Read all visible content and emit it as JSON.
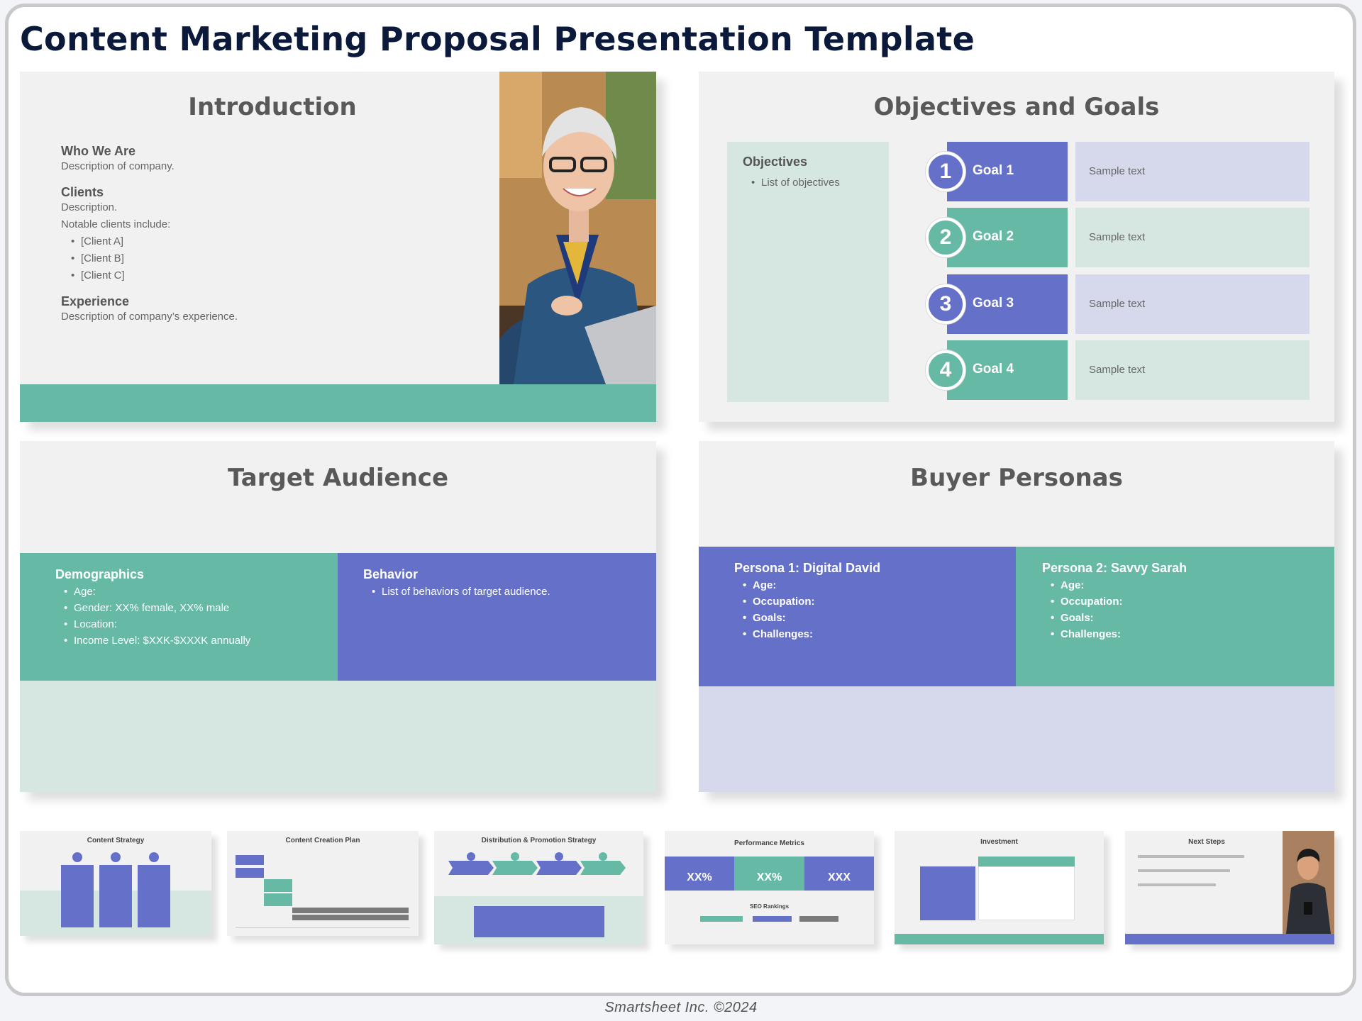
{
  "page": {
    "title": "Content Marketing Proposal Presentation Template",
    "footer": "Smartsheet Inc. ©2024"
  },
  "colors": {
    "green": "#66b9a5",
    "purple": "#6570c9",
    "light_green": "#d6e7e1",
    "light_purple": "#d6d9ec",
    "slide_bg": "#f1f1f1",
    "title": "#0b1a3a"
  },
  "intro": {
    "title": "Introduction",
    "who_heading": "Who We Are",
    "who_desc": "Description of company.",
    "clients_heading": "Clients",
    "clients_desc": "Description.",
    "clients_notable": "Notable clients include:",
    "clients": [
      "[Client A]",
      "[Client B]",
      "[Client C]"
    ],
    "exp_heading": "Experience",
    "exp_desc": "Description of company’s experience."
  },
  "objectives": {
    "title": "Objectives and Goals",
    "obj_heading": "Objectives",
    "obj_item": "List of objectives",
    "goals": [
      {
        "num": "1",
        "label": "Goal 1",
        "text": "Sample text"
      },
      {
        "num": "2",
        "label": "Goal 2",
        "text": "Sample text"
      },
      {
        "num": "3",
        "label": "Goal 3",
        "text": "Sample text"
      },
      {
        "num": "4",
        "label": "Goal 4",
        "text": "Sample text"
      }
    ]
  },
  "audience": {
    "title": "Target Audience",
    "demo_heading": "Demographics",
    "demo_items": [
      "Age:",
      "Gender: XX% female, XX% male",
      "Location:",
      "Income Level: $XXK-$XXXK annually"
    ],
    "behavior_heading": "Behavior",
    "behavior_item": "List of behaviors of target audience."
  },
  "personas": {
    "title": "Buyer Personas",
    "p1_heading": "Persona 1: Digital David",
    "p2_heading": "Persona 2: Savvy Sarah",
    "fields": [
      "Age:",
      "Occupation:",
      "Goals:",
      "Challenges:"
    ]
  },
  "thumbnails": {
    "strategy": "Content Strategy",
    "creation": "Content Creation Plan",
    "distribution": "Distribution & Promotion Strategy",
    "metrics": "Performance Metrics",
    "metrics_values": [
      "XX%",
      "XX%",
      "XXX"
    ],
    "seo": "SEO Rankings",
    "investment": "Investment",
    "next": "Next Steps"
  }
}
